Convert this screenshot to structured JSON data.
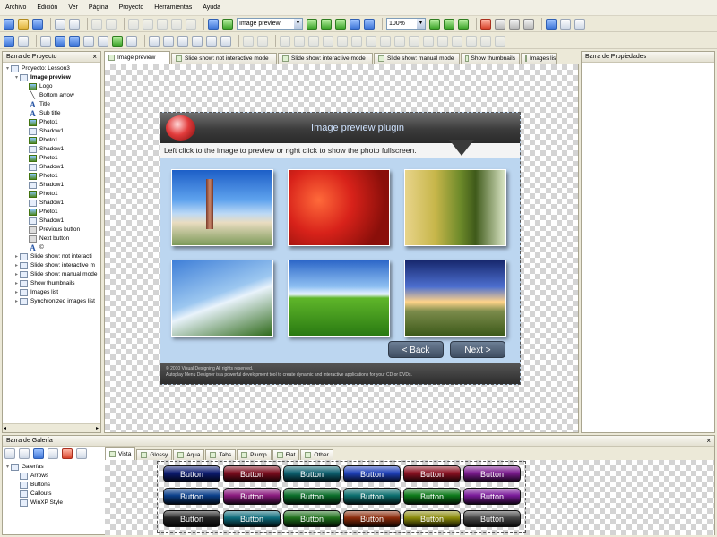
{
  "menu": [
    "Archivo",
    "Edición",
    "Ver",
    "Página",
    "Proyecto",
    "Herramientas",
    "Ayuda"
  ],
  "toolbar": {
    "page_select": "Image preview",
    "zoom": "100%"
  },
  "project_panel": {
    "title": "Barra de Proyecto",
    "items": [
      {
        "label": "Proyecto: Lesson3",
        "level": 0,
        "icon": "project",
        "bold": false
      },
      {
        "label": "Image preview",
        "level": 1,
        "icon": "page",
        "bold": true
      },
      {
        "label": "Logo",
        "level": 2,
        "icon": "img"
      },
      {
        "label": "Bottom arrow",
        "level": 2,
        "icon": "arr"
      },
      {
        "label": "Title",
        "level": 2,
        "icon": "txt"
      },
      {
        "label": "Sub title",
        "level": 2,
        "icon": "txt"
      },
      {
        "label": "Photo1",
        "level": 2,
        "icon": "img"
      },
      {
        "label": "Shadow1",
        "level": 2,
        "icon": "page"
      },
      {
        "label": "Photo1",
        "level": 2,
        "icon": "img"
      },
      {
        "label": "Shadow1",
        "level": 2,
        "icon": "page"
      },
      {
        "label": "Photo1",
        "level": 2,
        "icon": "img"
      },
      {
        "label": "Shadow1",
        "level": 2,
        "icon": "page"
      },
      {
        "label": "Photo1",
        "level": 2,
        "icon": "img"
      },
      {
        "label": "Shadow1",
        "level": 2,
        "icon": "page"
      },
      {
        "label": "Photo1",
        "level": 2,
        "icon": "img"
      },
      {
        "label": "Shadow1",
        "level": 2,
        "icon": "page"
      },
      {
        "label": "Photo1",
        "level": 2,
        "icon": "img"
      },
      {
        "label": "Shadow1",
        "level": 2,
        "icon": "page"
      },
      {
        "label": "Previous button",
        "level": 2,
        "icon": "btn"
      },
      {
        "label": "Next button",
        "level": 2,
        "icon": "btn"
      },
      {
        "label": "©",
        "level": 2,
        "icon": "txt"
      },
      {
        "label": "Slide show: not interacti",
        "level": 1,
        "icon": "page"
      },
      {
        "label": "Slide show: interactive m",
        "level": 1,
        "icon": "page"
      },
      {
        "label": "Slide show: manual mode",
        "level": 1,
        "icon": "page"
      },
      {
        "label": "Show thumbnails",
        "level": 1,
        "icon": "page"
      },
      {
        "label": "Images list",
        "level": 1,
        "icon": "page"
      },
      {
        "label": "Synchronized images list",
        "level": 1,
        "icon": "page"
      }
    ]
  },
  "page_tabs": [
    "Image preview",
    "Slide show: not interactive mode",
    "Slide show: interactive mode",
    "Slide show: manual mode",
    "Show thumbnails",
    "Images lis"
  ],
  "properties_panel": {
    "title": "Barra de Propiedades"
  },
  "plugin": {
    "title": "Image preview plugin",
    "subtitle": "Left click to the image to preview or right click to show the photo fullscreen.",
    "prev": "< Back",
    "next": "Next >",
    "footer1": "© 2010 Visual Designing All rights reserved.",
    "footer2": "Autoplay Menu Designer is a powerful development tool to create dynamic and interactive applications for your CD or DVDs."
  },
  "gallery_panel": {
    "title": "Barra de Galería",
    "tree": [
      {
        "label": "Galerías",
        "level": 0
      },
      {
        "label": "Arrows",
        "level": 1
      },
      {
        "label": "Buttons",
        "level": 1
      },
      {
        "label": "Callouts",
        "level": 1
      },
      {
        "label": "WinXP Style",
        "level": 1
      }
    ],
    "tabs": [
      "Vista",
      "Glossy",
      "Aqua",
      "Tabs",
      "Plump",
      "Flat",
      "Other"
    ],
    "button_label": "Button",
    "button_colors": [
      [
        "#0b1a6e",
        "#7a0b1c",
        "#0c5f6e",
        "#1d3fb8",
        "#8a1020",
        "#7a1a8e"
      ],
      [
        "#0b3f8a",
        "#8a1a7e",
        "#0b6e2a",
        "#0c6e6e",
        "#0d7a1a",
        "#7a1a9a"
      ],
      [
        "#222222",
        "#0c6a7a",
        "#1d6e1a",
        "#8a2a0a",
        "#8a8a0a",
        "#444444"
      ]
    ]
  }
}
